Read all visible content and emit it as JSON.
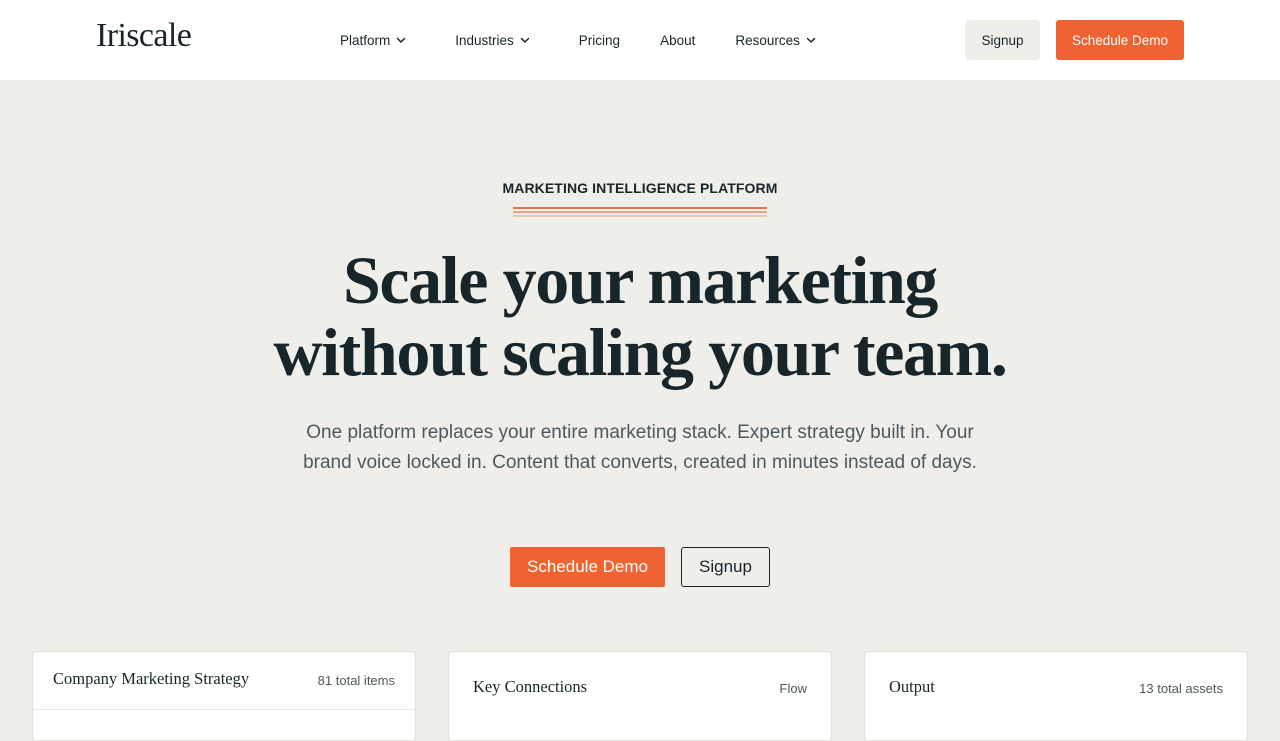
{
  "header": {
    "logo": "Iriscale",
    "nav": [
      {
        "label": "Platform",
        "has_dropdown": true
      },
      {
        "label": "Industries",
        "has_dropdown": true
      },
      {
        "label": "Pricing",
        "has_dropdown": false
      },
      {
        "label": "About",
        "has_dropdown": false
      },
      {
        "label": "Resources",
        "has_dropdown": true
      }
    ],
    "signup_label": "Signup",
    "demo_label": "Schedule Demo"
  },
  "hero": {
    "eyebrow": "MARKETING INTELLIGENCE PLATFORM",
    "headline_line1": "Scale your marketing",
    "headline_line2": "without scaling your team.",
    "subcopy": "One platform replaces your entire marketing stack. Expert strategy built in. Your brand voice locked in. Content that converts, created in minutes instead of days.",
    "cta_primary": "Schedule Demo",
    "cta_secondary": "Signup"
  },
  "cards": [
    {
      "title": "Company Marketing Strategy",
      "meta": "81 total items"
    },
    {
      "title": "Key Connections",
      "meta": "Flow"
    },
    {
      "title": "Output",
      "meta": "13 total assets"
    }
  ],
  "colors": {
    "accent": "#ee6331",
    "background": "#f0eee9",
    "text": "#17262b",
    "muted_text": "#4b5a5e"
  },
  "icons": {
    "dropdown": "chevron-down-icon"
  }
}
